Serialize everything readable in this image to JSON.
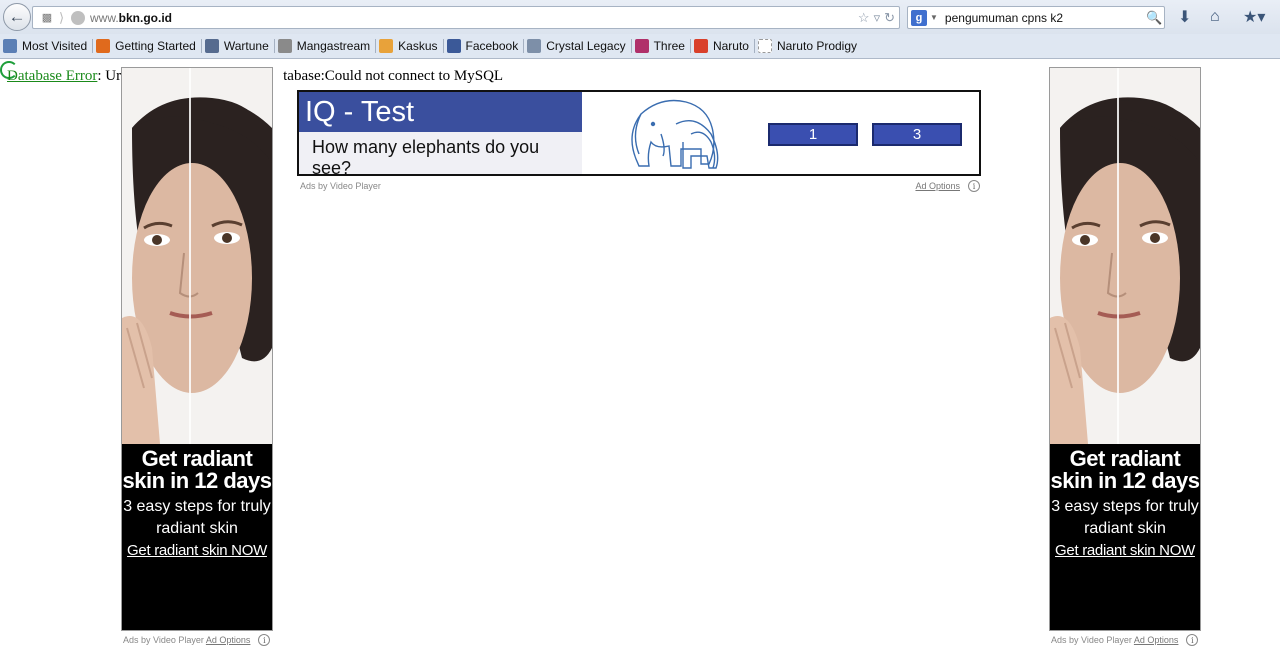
{
  "browser": {
    "url_prefix": "www.",
    "url_domain": "bkn.go.id",
    "search_engine_letter": "g",
    "search_query": "pengumuman cpns k2",
    "bookmarks": [
      {
        "label": "Most Visited",
        "icon": "most-visited-icon",
        "color": "#5b7fb5"
      },
      {
        "label": "Getting Started",
        "icon": "firefox-icon",
        "color": "#e06a1d"
      },
      {
        "label": "Wartune",
        "icon": "wartune-icon",
        "color": "#566b8f"
      },
      {
        "label": "Mangastream",
        "icon": "mangastream-icon",
        "color": "#8a8a8a"
      },
      {
        "label": "Kaskus",
        "icon": "kaskus-icon",
        "color": "#e8a23a"
      },
      {
        "label": "Facebook",
        "icon": "facebook-icon",
        "color": "#3b5998"
      },
      {
        "label": "Crystal Legacy",
        "icon": "crystal-legacy-icon",
        "color": "#7d8fa8"
      },
      {
        "label": "Three",
        "icon": "three-icon",
        "color": "#b0306a"
      },
      {
        "label": "Naruto",
        "icon": "naruto-icon",
        "color": "#d9402b"
      },
      {
        "label": "Naruto Prodigy",
        "icon": "blank-page-icon",
        "color": "#ffffff"
      }
    ]
  },
  "page": {
    "error_link": "Database Error",
    "error_text_start": ": Ur",
    "error_text_end": "tabase:Could not connect to MySQL"
  },
  "ads": {
    "sky_headline": "Get radiant skin in 12 days",
    "sky_sub": "3 easy steps for truly radiant skin",
    "sky_cta": "Get radiant skin NOW",
    "ads_by": "Ads by Video Player",
    "ad_options": "Ad Options",
    "info_glyph": "i",
    "iq_title": "IQ - Test",
    "iq_question": "How many elephants do you see?",
    "iq_answers": [
      "1",
      "3"
    ]
  }
}
